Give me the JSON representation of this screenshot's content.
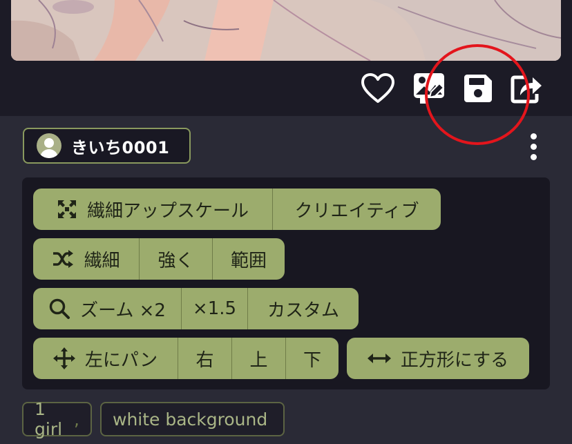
{
  "header_icons": [
    "heart-icon",
    "image-edit-icon",
    "save-icon",
    "share-icon"
  ],
  "author": {
    "name": "きいち0001",
    "icon": "user-avatar-icon"
  },
  "menu_icon": "more-vertical-icon",
  "actions": {
    "row1": {
      "icon": "expand-icon",
      "items": [
        "繊細アップスケール",
        "クリエイティブ"
      ]
    },
    "row2": {
      "icon": "shuffle-icon",
      "items": [
        "繊細",
        "強く",
        "範囲"
      ]
    },
    "row3": {
      "icon": "search-icon",
      "items": [
        "ズーム ×2",
        "×1.5",
        "カスタム"
      ]
    },
    "row4": {
      "icon": "move-icon",
      "items": [
        "左にパン",
        "右",
        "上",
        "下"
      ]
    },
    "square": {
      "icon": "arrows-horizontal-icon",
      "label": "正方形にする"
    }
  },
  "tags": [
    "1 girl",
    "white background"
  ],
  "tag_separator": ",",
  "colors": {
    "background": "#1c1b26",
    "card": "#2a2a36",
    "panel": "#181721",
    "button": "#9cac6d",
    "button_text": "#1f2417",
    "annotation": "#e3151c"
  }
}
